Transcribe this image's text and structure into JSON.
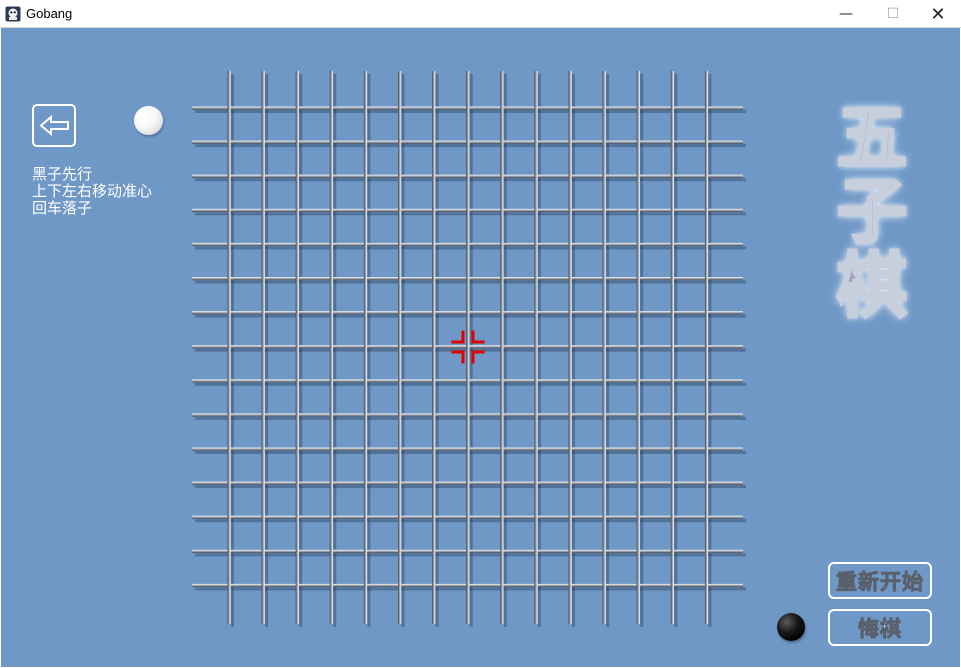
{
  "window": {
    "title": "Gobang",
    "minimize_glyph": "—",
    "maximize_glyph": "☐",
    "close_glyph": "✕"
  },
  "sidebar": {
    "back_icon": "arrow-left-icon",
    "turn_stone": "white",
    "help_lines": [
      "黑子先行",
      "上下左右移动准心",
      "回车落子"
    ]
  },
  "board": {
    "lines": 15,
    "cursor_column": 8,
    "cursor_row": 8,
    "cursor_color": "#e00000",
    "background": "#6f98c7"
  },
  "logo": {
    "chars": [
      "五",
      "子",
      "棋"
    ]
  },
  "buttons": {
    "restart_label": "重新开始",
    "undo_label": "悔棋"
  },
  "bottom_stone": "black"
}
